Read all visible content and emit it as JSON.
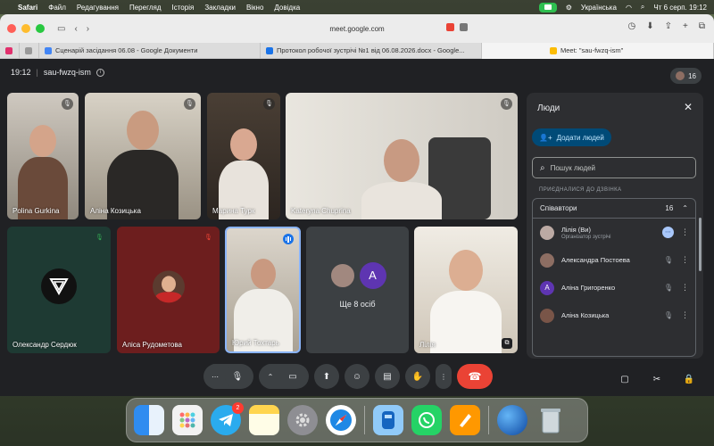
{
  "menubar": {
    "items": [
      "Safari",
      "Файл",
      "Редагування",
      "Перегляд",
      "Історія",
      "Закладки",
      "Вікно",
      "Довідка"
    ],
    "keyboard": "Українська",
    "datetime": "Чт 6 серп. 19:12"
  },
  "browser": {
    "address": "meet.google.com",
    "tabs": [
      {
        "label": "Сценарій засідання 06.08 - Google Документи",
        "color": "#4285f4"
      },
      {
        "label": "Протокол робочої зустрічі №1 від 06.08.2026.docx - Google...",
        "color": "#1a73e8"
      },
      {
        "label": "Meet: \"sau-fwzq-ism\"",
        "color": "#fbbc04"
      }
    ]
  },
  "meet": {
    "time": "19:12",
    "code": "sau-fwzq-ism",
    "participant_count": "16",
    "tiles": [
      {
        "name": "Polina Gurkina"
      },
      {
        "name": "Аліна Козицька"
      },
      {
        "name": "Марина Турк"
      },
      {
        "name": "Kateryna Chuprina"
      },
      {
        "name": "Олександр Сердюк"
      },
      {
        "name": "Аліса Рудометова"
      },
      {
        "name": "Юрий Тохтарь"
      },
      {
        "name": "Ще 8 осіб"
      },
      {
        "name": "Лілія"
      }
    ],
    "more_avatar_letter": "A"
  },
  "panel": {
    "title": "Люди",
    "add_label": "Додати людей",
    "search_placeholder": "Пошук людей",
    "section": "ПРИЄДНАЛИСЯ ДО ДЗВІНКА",
    "group_title": "Співавтори",
    "group_count": "16",
    "people": [
      {
        "name": "Лілія (Ви)",
        "role": "Організатор зустрічі",
        "color": "#bcaaa4"
      },
      {
        "name": "Александра Постоева",
        "role": "",
        "color": "#8d6e63"
      },
      {
        "name": "Аліна Григоренко",
        "role": "",
        "letter": "А"
      },
      {
        "name": "Аліна Козицька",
        "role": "",
        "color": "#795548"
      }
    ]
  }
}
